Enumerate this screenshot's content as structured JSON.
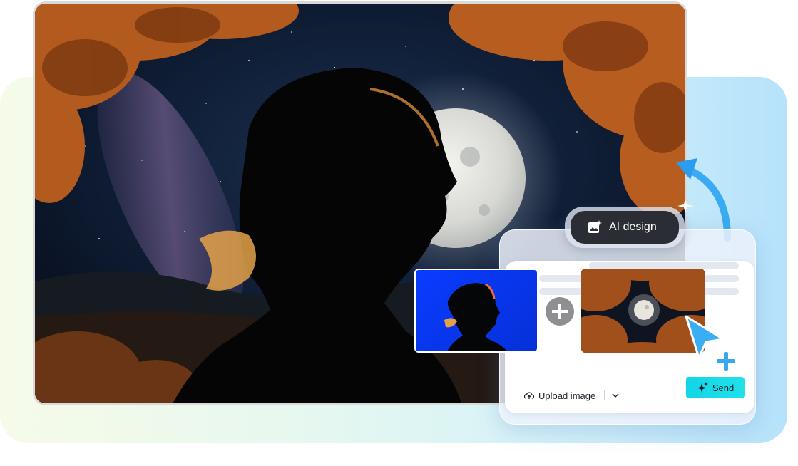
{
  "ai_chip": {
    "label": "AI design",
    "icon": "image-sparkle-icon"
  },
  "composer": {
    "upload_label": "Upload image",
    "send_label": "Send"
  },
  "colors": {
    "send_button": "#12d6e6",
    "chip_bg": "#2a2d33",
    "arrow_blue": "#2aa3f0"
  }
}
